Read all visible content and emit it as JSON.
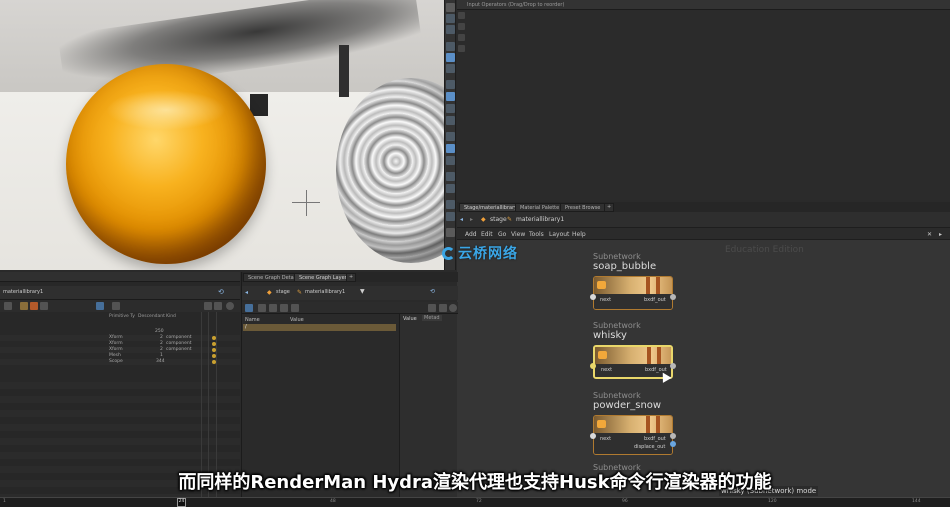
{
  "ops_pane": {
    "header": "Input Operators (Drag/Drop to reorder)"
  },
  "network": {
    "tabs": [
      "Stage/materiallibrary1",
      "Material Palette",
      "Preset Browse"
    ],
    "path": [
      "stage",
      "materiallibrary1"
    ],
    "menu": [
      "Add",
      "Edit",
      "Go",
      "View",
      "Tools",
      "Layout",
      "Help"
    ],
    "watermark": "Education Edition",
    "nodes": [
      {
        "type": "Subnetwork",
        "name": "soap_bubble",
        "in": "next",
        "out": "bxdf_out",
        "selected": false
      },
      {
        "type": "Subnetwork",
        "name": "whisky",
        "in": "next",
        "out": "bxdf_out",
        "selected": true
      },
      {
        "type": "Subnetwork",
        "name": "powder_snow",
        "in": "next",
        "out": "bxdf_out",
        "out2": "displace_out",
        "selected": false
      }
    ],
    "partial_type": "Subnetwork",
    "tooltip": "whisky (Subnetwork) mode"
  },
  "scene_graph": {
    "path": "materiallibrary1",
    "columns": [
      "Primitive Ty",
      "Descendant",
      "Kind"
    ],
    "count": "250",
    "rows": [
      {
        "type": "Xform",
        "desc": "2",
        "kind": "component"
      },
      {
        "type": "Xform",
        "desc": "2",
        "kind": "component"
      },
      {
        "type": "Xform",
        "desc": "2",
        "kind": "component"
      },
      {
        "type": "Mesh",
        "desc": "1",
        "kind": ""
      },
      {
        "type": "Scope",
        "desc": "344",
        "kind": ""
      }
    ]
  },
  "layers": {
    "tabs": [
      "Scene Graph Details",
      "Scene Graph Layers"
    ],
    "path": [
      "stage",
      "materiallibrary1"
    ],
    "columns": [
      "Name",
      "Value"
    ],
    "side_columns": [
      "Value",
      "Metad"
    ],
    "selected_row": "/"
  },
  "timeline": {
    "current": "24",
    "ticks": [
      "1",
      "24",
      "48",
      "72",
      "96",
      "120",
      "144"
    ]
  },
  "subtitle": "而同样的RenderMan Hydra渲染代理也支持Husk命令行渲染器的功能",
  "logo": "云桥网络",
  "colors": {
    "node_border": "#b07a30",
    "selected_border": "#e9d76a",
    "logo": "#3aa6e6"
  }
}
